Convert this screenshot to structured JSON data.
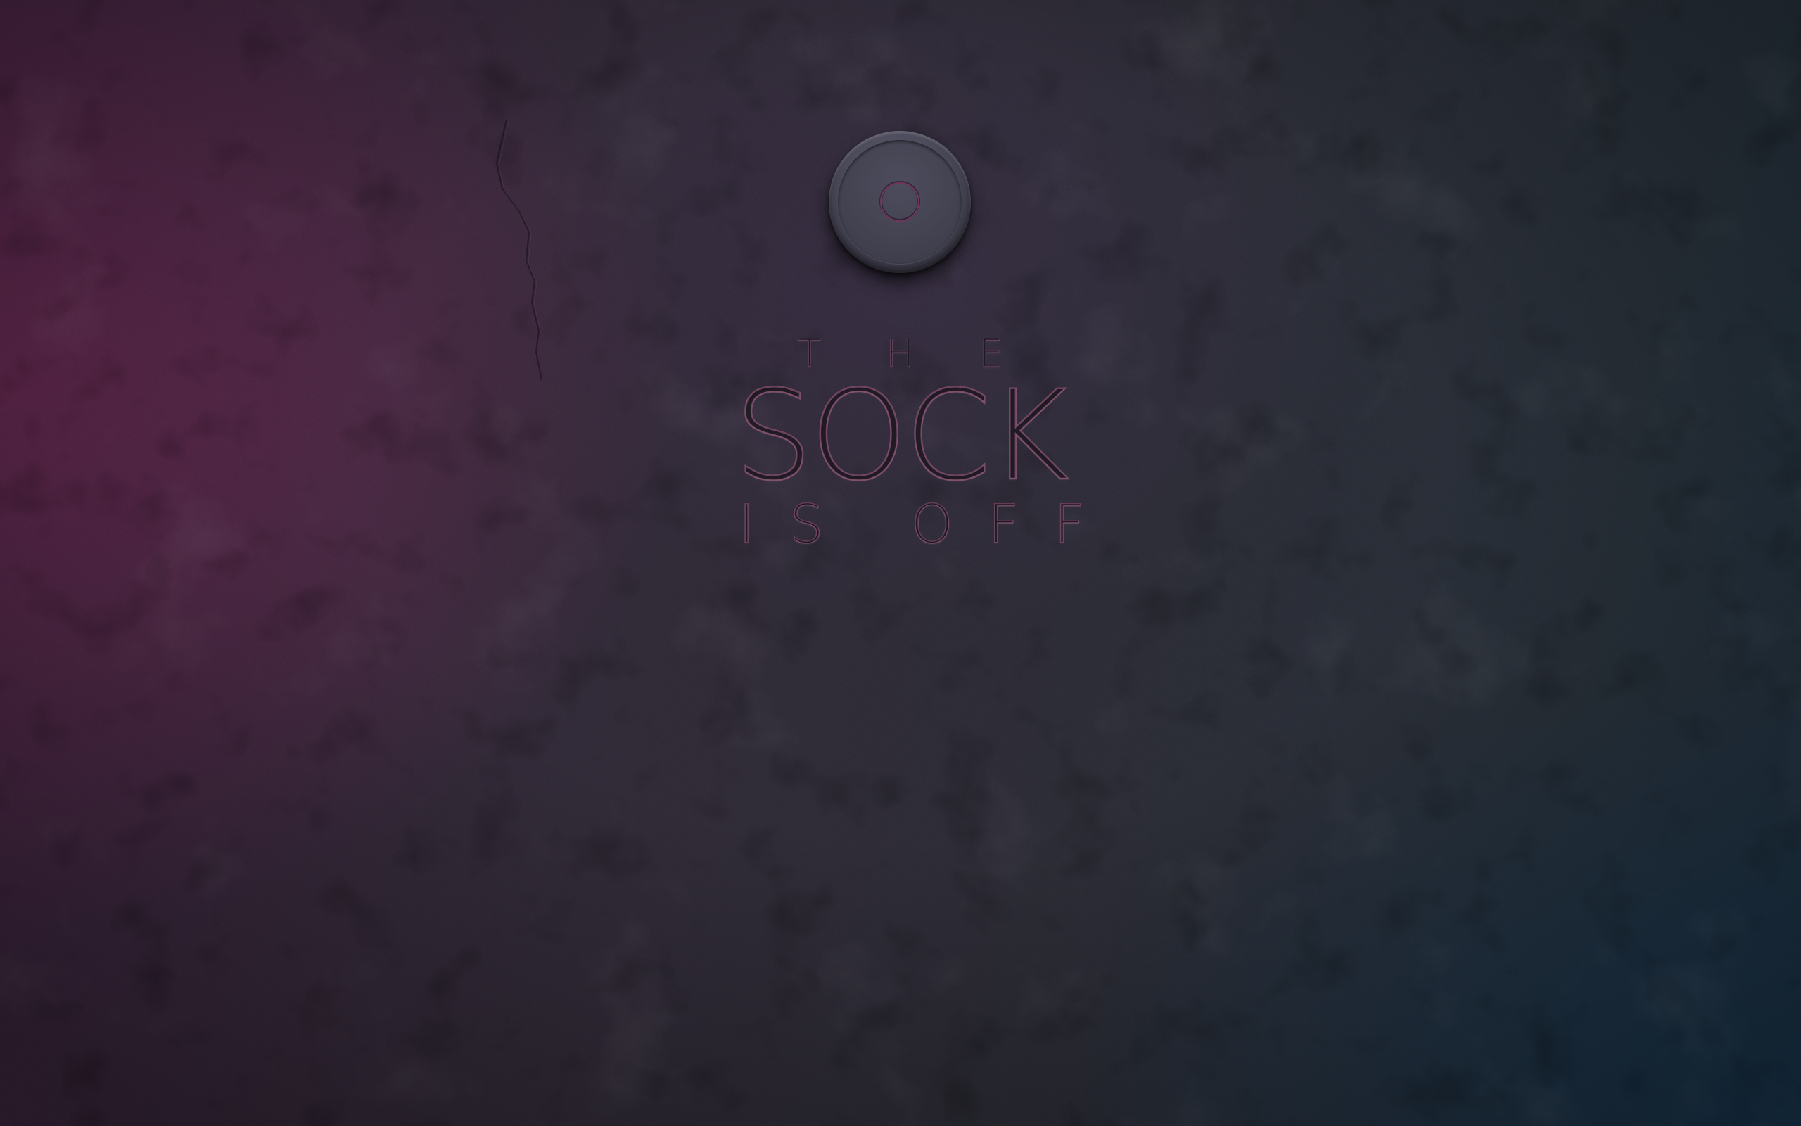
{
  "screen": {
    "palette": {
      "wall_magenta": "#762e5c",
      "wall_slate": "#33333e",
      "wall_blue": "#1c3e5c",
      "button_body": "#4a4959",
      "accent_ring": "#8a3a6e",
      "text_outline": "#a05f82"
    }
  },
  "power_button": {
    "icon": "power-ring-icon",
    "state": "off"
  },
  "title": {
    "line1": "THE",
    "line2": "SOCK",
    "line3": "IS OFF"
  }
}
